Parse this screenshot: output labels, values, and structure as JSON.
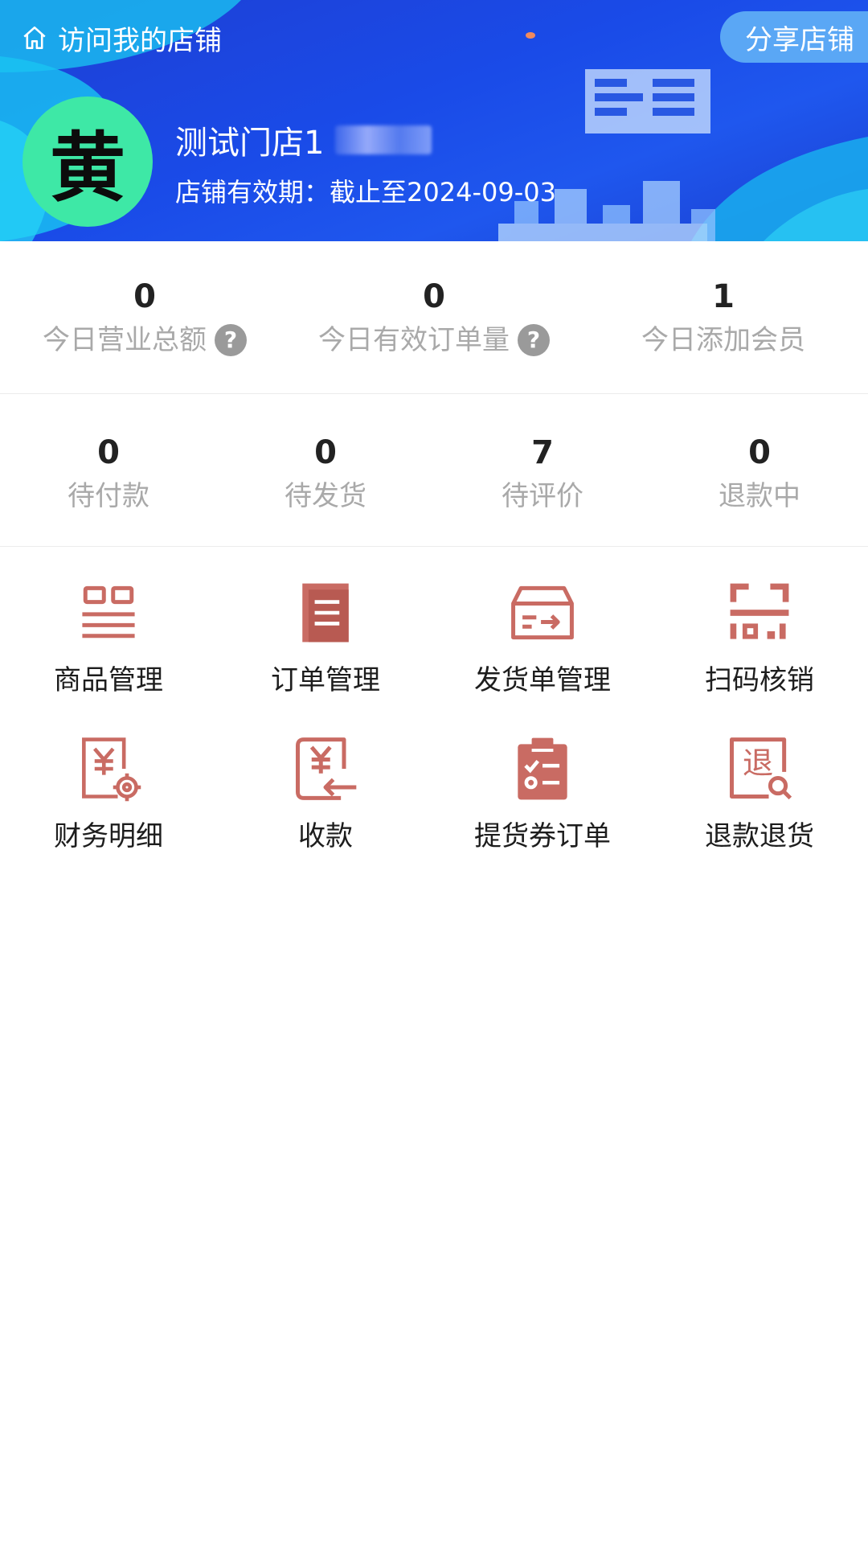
{
  "header": {
    "visit_link": "访问我的店铺",
    "share_button": "分享店铺",
    "avatar_char": "黄",
    "store_name": "测试门店1",
    "store_expiry": "店铺有效期：截止至2024-09-03"
  },
  "stats_today": [
    {
      "value": "0",
      "label": "今日营业总额",
      "has_help": true
    },
    {
      "value": "0",
      "label": "今日有效订单量",
      "has_help": true
    },
    {
      "value": "1",
      "label": "今日添加会员",
      "has_help": false
    }
  ],
  "stats_orders": [
    {
      "value": "0",
      "label": "待付款"
    },
    {
      "value": "0",
      "label": "待发货"
    },
    {
      "value": "7",
      "label": "待评价"
    },
    {
      "value": "0",
      "label": "退款中"
    }
  ],
  "functions": [
    {
      "label": "商品管理",
      "icon": "product-list-icon"
    },
    {
      "label": "订单管理",
      "icon": "order-document-icon"
    },
    {
      "label": "发货单管理",
      "icon": "shipping-box-icon"
    },
    {
      "label": "扫码核销",
      "icon": "qr-scan-icon"
    },
    {
      "label": "财务明细",
      "icon": "finance-gear-icon"
    },
    {
      "label": "收款",
      "icon": "payment-receive-icon"
    },
    {
      "label": "提货券订单",
      "icon": "pickup-clipboard-icon"
    },
    {
      "label": "退款退货",
      "icon": "refund-search-icon"
    }
  ],
  "colors": {
    "accent_icon": "#c96b63",
    "header_blue": "#1a4be8",
    "avatar_green": "#3ee8a6",
    "share_button_bg": "#5aa7f5"
  }
}
